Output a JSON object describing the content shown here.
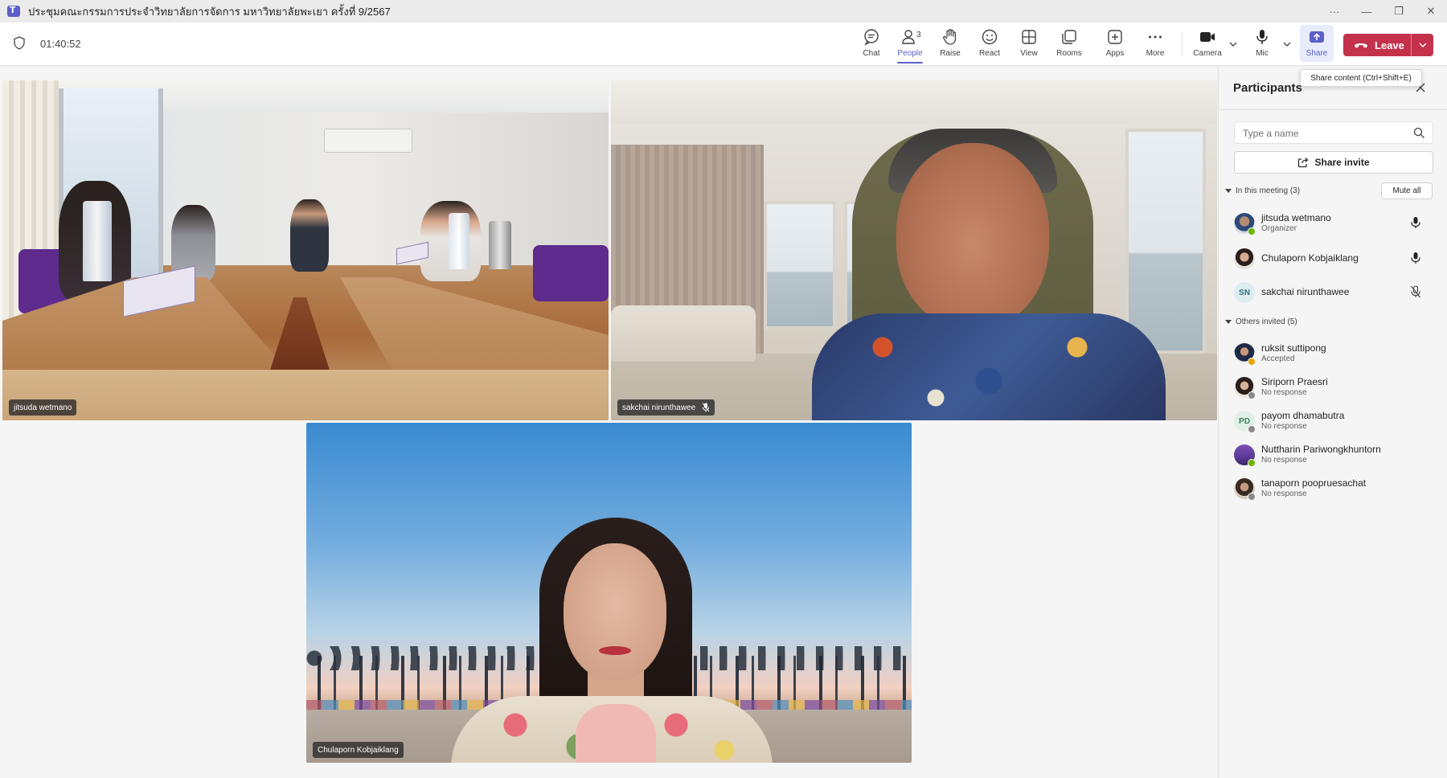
{
  "window": {
    "title": "ประชุมคณะกรรมการประจำวิทยาลัยการจัดการ มหาวิทยาลัยพะเยา ครั้งที่ 9/2567",
    "more": "···",
    "minimize": "—",
    "maximize": "❐",
    "close": "✕"
  },
  "toolbar": {
    "timer": "01:40:52",
    "chat": "Chat",
    "people": "People",
    "people_count": "3",
    "raise": "Raise",
    "react": "React",
    "view": "View",
    "rooms": "Rooms",
    "apps": "Apps",
    "more": "More",
    "camera": "Camera",
    "mic": "Mic",
    "share": "Share",
    "leave": "Leave",
    "share_tooltip": "Share content (Ctrl+Shift+E)"
  },
  "tiles": [
    {
      "name": "jitsuda wetmano",
      "muted": false
    },
    {
      "name": "sakchai nirunthawee",
      "muted": true
    },
    {
      "name": "Chulaporn Kobjaiklang",
      "muted": false
    }
  ],
  "participants": {
    "title": "Participants",
    "search_placeholder": "Type a name",
    "share_invite": "Share invite",
    "in_meeting_header": "In this meeting (3)",
    "mute_all": "Mute all",
    "in_meeting": [
      {
        "name": "jitsuda wetmano",
        "role": "Organizer",
        "mic": "on",
        "status_color": "#6bb700"
      },
      {
        "name": "Chulaporn Kobjaiklang",
        "role": "",
        "mic": "on",
        "status_color": ""
      },
      {
        "name": "sakchai nirunthawee",
        "initials": "SN",
        "role": "",
        "mic": "muted",
        "status_color": ""
      }
    ],
    "others_header": "Others invited (5)",
    "others": [
      {
        "name": "ruksit suttipong",
        "status": "Accepted",
        "status_color": "#eaa300"
      },
      {
        "name": "Siriporn Praesri",
        "status": "No response",
        "status_color": "#8a8886"
      },
      {
        "name": "payom dhamabutra",
        "initials": "PD",
        "status": "No response",
        "status_color": "#8a8886"
      },
      {
        "name": "Nuttharin Pariwongkhuntorn",
        "status": "No response",
        "status_color": "#6bb700"
      },
      {
        "name": "tanaporn poopruesachat",
        "status": "No response",
        "status_color": "#8a8886"
      }
    ]
  },
  "colors": {
    "accent": "#5b5fc7",
    "leave": "#c4314b",
    "available": "#6bb700",
    "away": "#eaa300"
  }
}
